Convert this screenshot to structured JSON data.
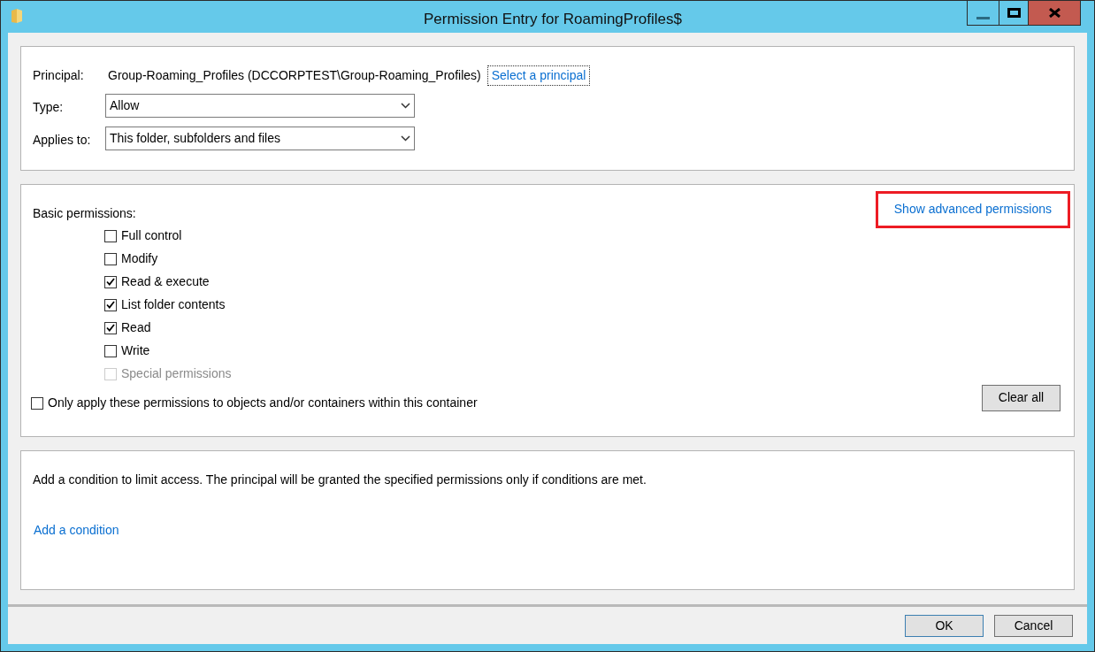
{
  "window": {
    "title": "Permission Entry for RoamingProfiles$"
  },
  "principal": {
    "label": "Principal:",
    "value": "Group-Roaming_Profiles (DCCORPTEST\\Group-Roaming_Profiles)",
    "link": "Select a principal",
    "focused": true
  },
  "fields": [
    {
      "label": "Type:",
      "value": "Allow"
    },
    {
      "label": "Applies to:",
      "value": "This folder, subfolders and files"
    }
  ],
  "permissions": {
    "heading": "Basic permissions:",
    "advanced_link": {
      "label": "Show advanced permissions",
      "highlighted": true
    },
    "items": [
      {
        "label": "Full control",
        "checked": false,
        "disabled": false
      },
      {
        "label": "Modify",
        "checked": false,
        "disabled": false
      },
      {
        "label": "Read & execute",
        "checked": true,
        "disabled": false
      },
      {
        "label": "List folder contents",
        "checked": true,
        "disabled": false
      },
      {
        "label": "Read",
        "checked": true,
        "disabled": false
      },
      {
        "label": "Write",
        "checked": false,
        "disabled": false
      },
      {
        "label": "Special permissions",
        "checked": false,
        "disabled": true
      }
    ],
    "only_apply": {
      "label": "Only apply these permissions to objects and/or containers within this container",
      "checked": false
    },
    "clear_button": "Clear all"
  },
  "condition": {
    "text": "Add a condition to limit access. The principal will be granted the specified permissions only if conditions are met.",
    "link": "Add a condition"
  },
  "buttons": [
    {
      "label": "OK",
      "default": true
    },
    {
      "label": "Cancel",
      "default": false
    }
  ]
}
